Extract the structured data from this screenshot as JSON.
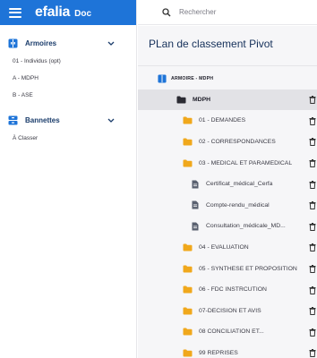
{
  "app": {
    "brand": "efalia",
    "brand_sub": "Doc"
  },
  "search": {
    "placeholder": "Rechercher"
  },
  "sidebar": {
    "armoires": {
      "title": "Armoires",
      "items": [
        {
          "label": "01 - Individus (opt)"
        },
        {
          "label": "A - MDPH"
        },
        {
          "label": "B - ASE"
        }
      ]
    },
    "bannettes": {
      "title": "Bannettes",
      "items": [
        {
          "label": "À Classer"
        }
      ]
    }
  },
  "main": {
    "title": "PLan de classement Pivot",
    "tree": [
      {
        "label": "ARMOIRE - MDPH",
        "type": "armoire"
      },
      {
        "label": "MDPH",
        "type": "folder-root"
      },
      {
        "label": "01 - DEMANDES",
        "type": "folder"
      },
      {
        "label": "02 - CORRESPONDANCES",
        "type": "folder"
      },
      {
        "label": "03 - MEDICAL ET PARAMEDICAL",
        "type": "folder"
      },
      {
        "label": "Certificat_médical_Cerfa",
        "type": "doc"
      },
      {
        "label": "Compte-rendu_médical",
        "type": "doc"
      },
      {
        "label": "Consultation_médicale_MD...",
        "type": "doc"
      },
      {
        "label": "04 - EVALUATION",
        "type": "folder"
      },
      {
        "label": "05 - SYNTHESE ET PROPOSITION",
        "type": "folder"
      },
      {
        "label": "06 - FDC INSTRCUTION",
        "type": "folder"
      },
      {
        "label": "07-DECISION ET AVIS",
        "type": "folder"
      },
      {
        "label": "08 CONCILIATION ET...",
        "type": "folder"
      },
      {
        "label": "99 REPRISES",
        "type": "folder"
      }
    ]
  },
  "colors": {
    "brand_blue": "#1e74d8",
    "folder": "#f0a81c",
    "title": "#15305a"
  }
}
